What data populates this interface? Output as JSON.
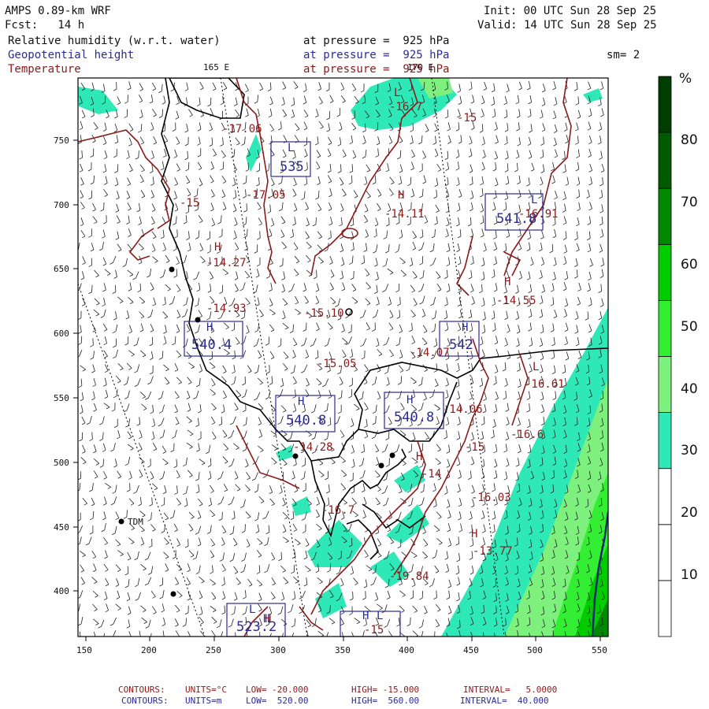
{
  "header": {
    "model": "AMPS 0.89-km WRF",
    "forecast": "Fcst:   14 h",
    "init": "Init: 00 UTC Sun 28 Sep 25",
    "valid": "Valid: 14 UTC Sun 28 Sep 25",
    "smoothing": "sm= 2"
  },
  "fields": [
    {
      "name": "Relative humidity (w.r.t. water)",
      "level": "at pressure =  925 hPa",
      "color": "#111111"
    },
    {
      "name": "Geopotential height",
      "level": "at pressure =  925 hPa",
      "color": "#2a2a9a"
    },
    {
      "name": "Temperature",
      "level": "at pressure =  925 hPa",
      "color": "#8b1a1a"
    }
  ],
  "lon_labels": [
    "165 E",
    "170 E"
  ],
  "axes": {
    "x_ticks": [
      "150",
      "200",
      "250",
      "300",
      "350",
      "400",
      "450",
      "500",
      "550"
    ],
    "y_ticks": [
      "750",
      "700",
      "650",
      "600",
      "550",
      "500",
      "450",
      "400"
    ]
  },
  "colorbar": {
    "unit": "%",
    "ticks": [
      "80",
      "70",
      "60",
      "50",
      "40",
      "30",
      "20",
      "10"
    ],
    "colors": [
      "#ffffff",
      "#ffffff",
      "#ffffff",
      "#2ee8b8",
      "#7ef07e",
      "#33ee33",
      "#00cc00",
      "#008800",
      "#005a00",
      "#003d00"
    ]
  },
  "station": "TDM",
  "geopotential_labels": [
    "L",
    "535",
    "L",
    "541.8",
    "H",
    "540.4",
    "H",
    "540.8",
    "H",
    "540.8",
    "H",
    "542",
    "L",
    "523.2",
    "H",
    "L",
    "H"
  ],
  "temperature_labels": [
    "-17.06",
    "-17.05",
    "-15",
    "-16.7",
    "-15",
    "-14.11",
    "-14.27",
    "-14.93",
    "-15.10",
    "-15.05",
    "-14.07",
    "-14.55",
    "-16.61",
    "-14.06",
    "-16.6",
    "-14.28",
    "-15",
    "-14",
    "-16.03",
    "-16.7",
    "-13.77",
    "-19.84",
    "-16.91",
    "-15",
    "L",
    "H",
    "H",
    "H",
    "L",
    "H",
    "H",
    "H"
  ],
  "footer": [
    {
      "contours": "CONTOURS:",
      "units": "UNITS=°C",
      "low": "LOW= -20.000",
      "high": "HIGH= -15.000",
      "interval": "INTERVAL=   5.0000"
    },
    {
      "contours": "CONTOURS:",
      "units": "UNITS=m",
      "low": "LOW=  520.00",
      "high": "HIGH=  560.00",
      "interval": "INTERVAL=  40.000"
    }
  ]
}
